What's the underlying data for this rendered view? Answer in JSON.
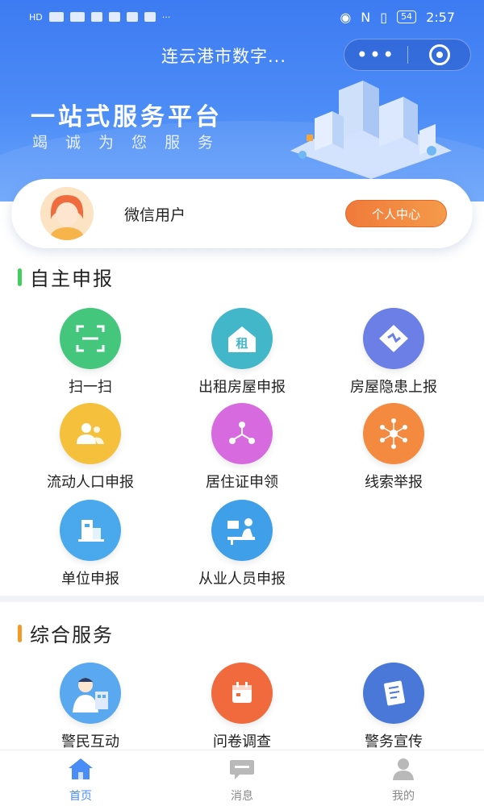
{
  "status_bar": {
    "left_label": "HD",
    "time": "2:57",
    "battery": "54"
  },
  "navbar": {
    "title": "连云港市数字...",
    "more_label": "•••"
  },
  "banner": {
    "slogan": "一站式服务平台",
    "sub_slogan": "竭诚为您服务"
  },
  "user": {
    "name": "微信用户",
    "center_button": "个人中心"
  },
  "sections": [
    {
      "title": "自主申报",
      "accent": "#3fcf5a",
      "items": [
        {
          "label": "扫一扫",
          "icon": "scan-icon",
          "color": "#44c77d"
        },
        {
          "label": "出租房屋申报",
          "icon": "rent-house-icon",
          "color": "#42b7c9"
        },
        {
          "label": "房屋隐患上报",
          "icon": "hazard-icon",
          "color": "#6b7fe6"
        },
        {
          "label": "流动人口申报",
          "icon": "people-icon",
          "color": "#f5c13d"
        },
        {
          "label": "居住证申领",
          "icon": "share-icon",
          "color": "#d86ae0"
        },
        {
          "label": "线索举报",
          "icon": "network-icon",
          "color": "#f48a3f"
        },
        {
          "label": "单位申报",
          "icon": "building-icon",
          "color": "#4aa8ec"
        },
        {
          "label": "从业人员申报",
          "icon": "worker-icon",
          "color": "#3f9fe8"
        }
      ]
    },
    {
      "title": "综合服务",
      "accent": "#f39a2a",
      "items": [
        {
          "label": "警民互动",
          "icon": "police-chat-icon",
          "color": "#5aa8ef"
        },
        {
          "label": "问卷调查",
          "icon": "calendar-icon",
          "color": "#f06a3e"
        },
        {
          "label": "警务宣传",
          "icon": "doc-icon",
          "color": "#4a78d8"
        }
      ]
    }
  ],
  "tabs": [
    {
      "label": "首页",
      "icon": "home-icon",
      "active": true
    },
    {
      "label": "消息",
      "icon": "message-icon",
      "active": false
    },
    {
      "label": "我的",
      "icon": "user-icon",
      "active": false
    }
  ],
  "colors": {
    "primary": "#3d7bf2",
    "tab_active": "#4a8df6",
    "tab_inactive": "#b9b9b9"
  }
}
